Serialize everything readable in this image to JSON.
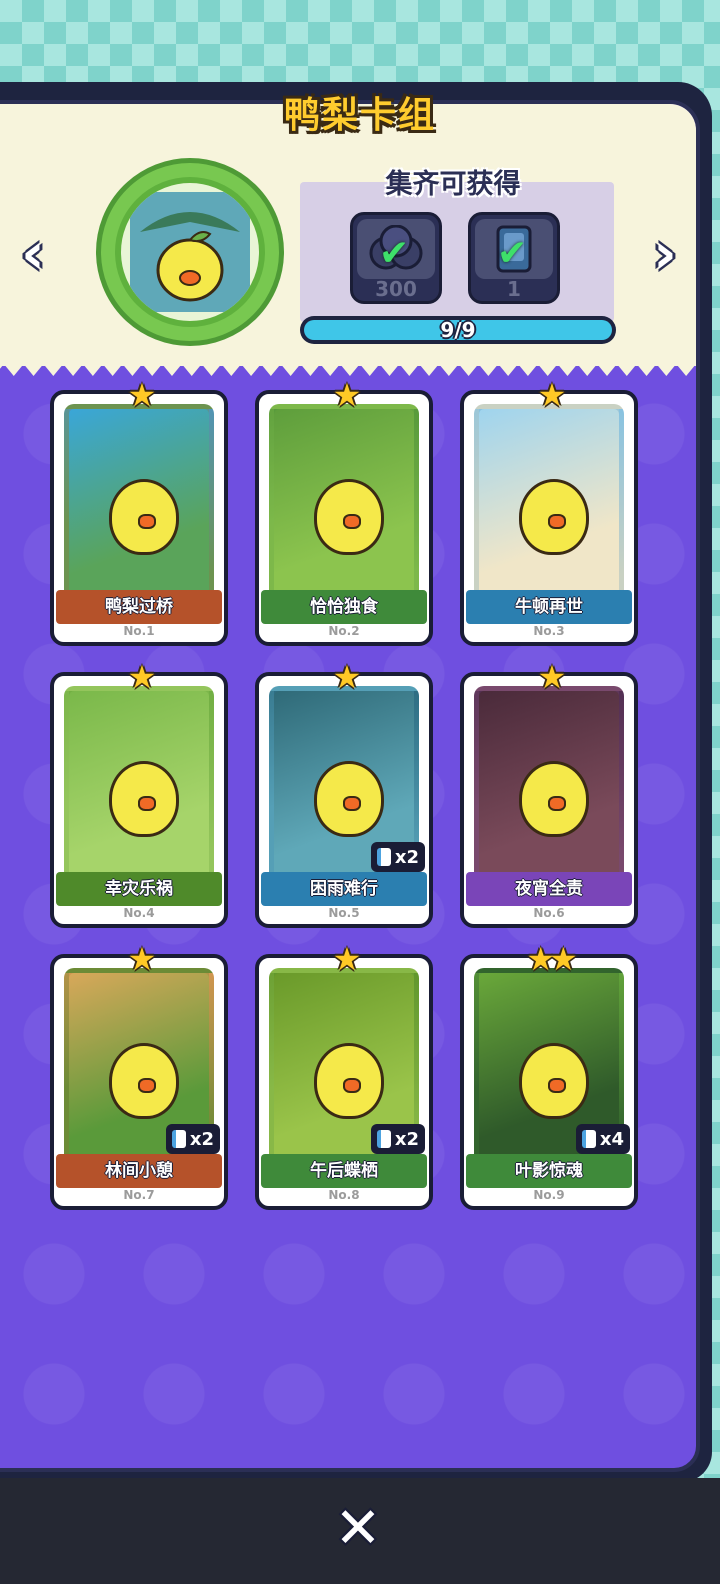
{
  "header": {
    "title": "鸭梨卡组"
  },
  "reward": {
    "title": "集齐可获得",
    "items": [
      {
        "icon": "coin-icon",
        "amount": "300",
        "claimed": true
      },
      {
        "icon": "card-pack-icon",
        "amount": "1",
        "claimed": true
      }
    ],
    "progress_text": "9/9",
    "progress_fraction": 1.0
  },
  "nav": {
    "prev": "‹",
    "next": "›"
  },
  "cards": [
    {
      "name": "鸭梨过桥",
      "number": "No.1",
      "stars": "★",
      "dup": "",
      "theme": "#b5522a",
      "bg": "#5aa45a",
      "bg2": "#3aa6d8"
    },
    {
      "name": "恰恰独食",
      "number": "No.2",
      "stars": "★",
      "dup": "",
      "theme": "#3f8a3a",
      "bg": "#8cc44e",
      "bg2": "#5e9e3c"
    },
    {
      "name": "牛顿再世",
      "number": "No.3",
      "stars": "★",
      "dup": "",
      "theme": "#2b7fb0",
      "bg": "#f0e6c8",
      "bg2": "#9fd4ee"
    },
    {
      "name": "幸灾乐祸",
      "number": "No.4",
      "stars": "★",
      "dup": "",
      "theme": "#4f8a2a",
      "bg": "#a6d46a",
      "bg2": "#7ab84a"
    },
    {
      "name": "困雨难行",
      "number": "No.5",
      "stars": "★",
      "dup": "x2",
      "theme": "#2b7fb0",
      "bg": "#5fa8b8",
      "bg2": "#2f6a78"
    },
    {
      "name": "夜宵全责",
      "number": "No.6",
      "stars": "★",
      "dup": "",
      "theme": "#7a45b8",
      "bg": "#7a4a5a",
      "bg2": "#4a2a3a"
    },
    {
      "name": "林间小憩",
      "number": "No.7",
      "stars": "★",
      "dup": "x2",
      "theme": "#b5522a",
      "bg": "#5a9a3a",
      "bg2": "#d8a85a"
    },
    {
      "name": "午后蝶栖",
      "number": "No.8",
      "stars": "★",
      "dup": "x2",
      "theme": "#3f8a3a",
      "bg": "#9ac44a",
      "bg2": "#6a9a2a"
    },
    {
      "name": "叶影惊魂",
      "number": "No.9",
      "stars": "★★",
      "dup": "x4",
      "theme": "#3f8a3a",
      "bg": "#2f5a2a",
      "bg2": "#6aa83a"
    }
  ],
  "close": {
    "label": "✕"
  }
}
